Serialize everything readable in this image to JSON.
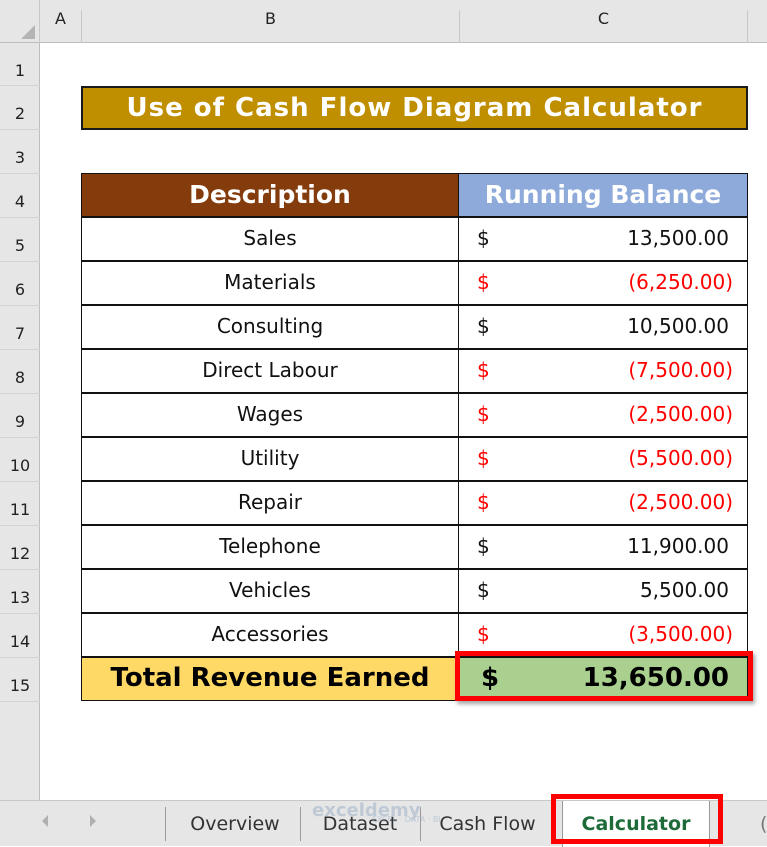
{
  "spreadsheet": {
    "columns": [
      "A",
      "B",
      "C"
    ],
    "rows": [
      "1",
      "2",
      "3",
      "4",
      "5",
      "6",
      "7",
      "8",
      "9",
      "10",
      "11",
      "12",
      "13",
      "14",
      "15"
    ]
  },
  "title": "Use of Cash Flow Diagram Calculator",
  "table": {
    "headers": {
      "description": "Description",
      "running_balance": "Running Balance"
    },
    "currency_symbol": "$",
    "rows": [
      {
        "description": "Sales",
        "amount": "13,500.00",
        "negative": false
      },
      {
        "description": "Materials",
        "amount": "(6,250.00)",
        "negative": true
      },
      {
        "description": "Consulting",
        "amount": "10,500.00",
        "negative": false
      },
      {
        "description": "Direct Labour",
        "amount": "(7,500.00)",
        "negative": true
      },
      {
        "description": "Wages",
        "amount": "(2,500.00)",
        "negative": true
      },
      {
        "description": "Utility",
        "amount": "(5,500.00)",
        "negative": true
      },
      {
        "description": "Repair",
        "amount": "(2,500.00)",
        "negative": true
      },
      {
        "description": "Telephone",
        "amount": "11,900.00",
        "negative": false
      },
      {
        "description": "Vehicles",
        "amount": "5,500.00",
        "negative": false
      },
      {
        "description": "Accessories",
        "amount": "(3,500.00)",
        "negative": true
      }
    ],
    "total": {
      "label": "Total Revenue Earned",
      "amount": "13,650.00"
    }
  },
  "sheet_tabs": {
    "tabs": [
      {
        "label": "Overview",
        "active": false
      },
      {
        "label": "Dataset",
        "active": false
      },
      {
        "label": "Cash Flow",
        "active": false
      },
      {
        "label": "Calculator",
        "active": true
      }
    ],
    "more_indicator": "("
  },
  "watermark": {
    "brand": "exceldemy",
    "tagline": "EXCEL · DATA · BI"
  },
  "colors": {
    "title_bg": "#bf8f00",
    "desc_header_bg": "#843c0c",
    "balance_header_bg": "#8eaadb",
    "total_label_bg": "#ffd966",
    "total_value_bg": "#a9d08e",
    "negative_text": "#ff0000",
    "highlight_border": "#ff0000",
    "active_tab_text": "#1e6b3a"
  }
}
